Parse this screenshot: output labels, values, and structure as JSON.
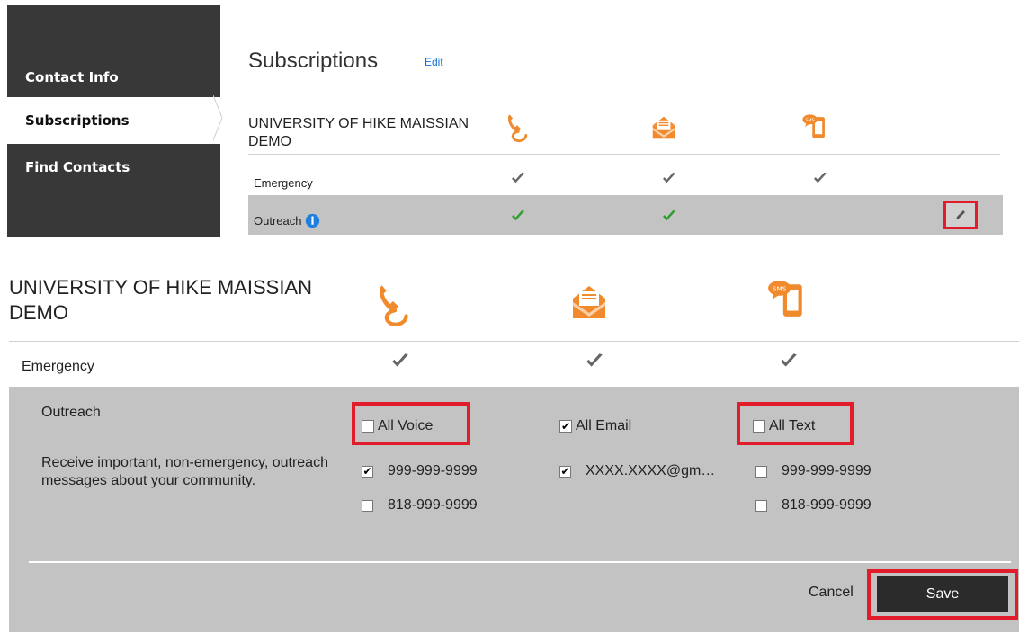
{
  "sidebar": {
    "items": [
      {
        "label": "Contact Info"
      },
      {
        "label": "Subscriptions"
      },
      {
        "label": "Find Contacts"
      }
    ]
  },
  "top": {
    "title": "Subscriptions",
    "edit_label": "Edit",
    "organization": "UNIVERSITY OF HIKE MAISSIAN DEMO",
    "rows": [
      {
        "label": "Emergency",
        "voice": "checked-gray",
        "email": "checked-gray",
        "text": "checked-gray"
      },
      {
        "label": "Outreach",
        "voice": "checked-green",
        "email": "checked-green",
        "text": ""
      }
    ]
  },
  "bottom": {
    "organization": "UNIVERSITY OF HIKE MAISSIAN DEMO",
    "emergency_label": "Emergency",
    "outreach": {
      "title": "Outreach",
      "description": "Receive important, non-emergency, outreach messages about your community.",
      "all_voice": {
        "label": "All Voice",
        "checked": false
      },
      "all_email": {
        "label": "All Email",
        "checked": true
      },
      "all_text": {
        "label": "All Text",
        "checked": false
      },
      "voice": [
        {
          "value": "999-999-9999",
          "checked": true
        },
        {
          "value": "818-999-9999",
          "checked": false
        }
      ],
      "email": [
        {
          "value": "XXXX.XXXX@gm…",
          "checked": true
        }
      ],
      "text": [
        {
          "value": "999-999-9999",
          "checked": false
        },
        {
          "value": "818-999-9999",
          "checked": false
        }
      ]
    },
    "cancel_label": "Cancel",
    "save_label": "Save"
  },
  "colors": {
    "accent_orange": "#f08a2c",
    "check_gray": "#666666",
    "check_green": "#2e9e2e",
    "highlight_red": "#e21c2a",
    "info_blue": "#1e7fe0"
  }
}
